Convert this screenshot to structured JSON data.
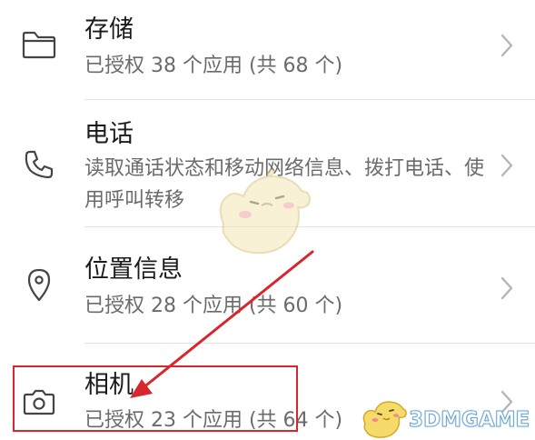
{
  "permissions": [
    {
      "icon": "folder-icon",
      "title": "存储",
      "subtitle": "已授权 38 个应用 (共 68 个)"
    },
    {
      "icon": "phone-icon",
      "title": "电话",
      "subtitle": "读取通话状态和移动网络信息、拨打电话、使用呼叫转移"
    },
    {
      "icon": "location-pin-icon",
      "title": "位置信息",
      "subtitle": "已授权 28 个应用 (共 60 个)"
    },
    {
      "icon": "camera-icon",
      "title": "相机",
      "subtitle": "已授权 23 个应用 (共 64 个)"
    }
  ],
  "watermark": {
    "brand": "3DMGAME"
  },
  "colors": {
    "annotation": "#d9262c",
    "title_text": "#1b1b1b",
    "subtitle_text": "#6b6b6b",
    "icon": "#444444",
    "chevron": "#b5b5b5",
    "watermark": "#6aa3cc"
  }
}
